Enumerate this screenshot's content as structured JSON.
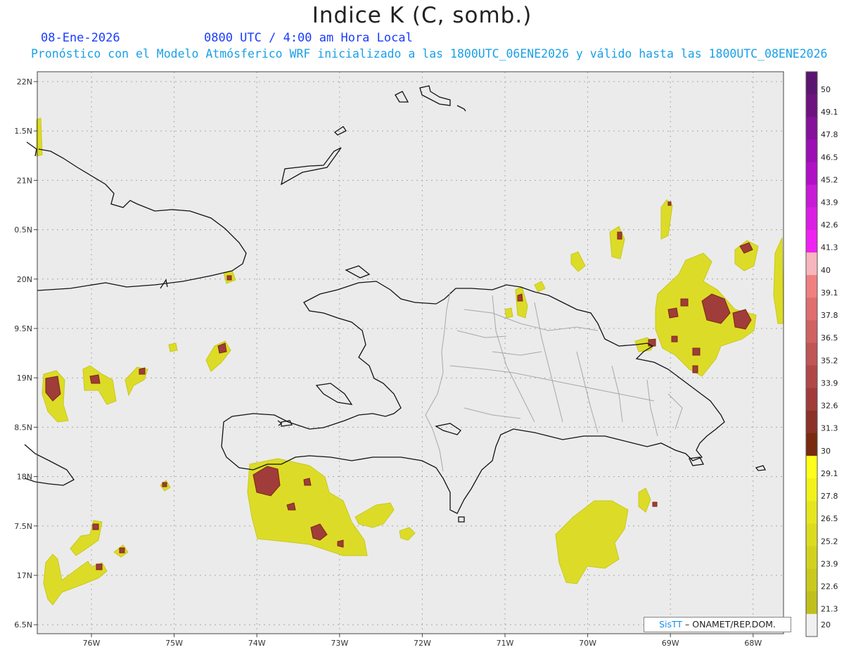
{
  "header": {
    "title": "Indice K (C, somb.)",
    "date": "08-Ene-2026",
    "time": "0800 UTC / 4:00 am Hora Local",
    "subtitle": "Pronóstico con el Modelo Atmósferico WRF inicializado a las 1800UTC_06ENE2026 y válido hasta las  1800UTC_08ENE2026"
  },
  "map": {
    "lat_ticks": [
      "22N",
      "1.5N",
      "21N",
      "0.5N",
      "20N",
      "9.5N",
      "19N",
      "8.5N",
      "18N",
      "7.5N",
      "17N",
      "6.5N"
    ],
    "lon_ticks": [
      "76W",
      "75W",
      "74W",
      "73W",
      "72W",
      "71W",
      "70W",
      "69W",
      "68W"
    ],
    "background_color": "#ebebeb"
  },
  "colorbar": {
    "labels": [
      "50",
      "49.1",
      "47.8",
      "46.5",
      "45.2",
      "43.9",
      "42.6",
      "41.3",
      "40",
      "39.1",
      "37.8",
      "36.5",
      "35.2",
      "33.9",
      "32.6",
      "31.3",
      "30",
      "29.1",
      "27.8",
      "26.5",
      "25.2",
      "23.9",
      "22.6",
      "21.3",
      "20"
    ],
    "colors": [
      "#5a1570",
      "#6e1280",
      "#86119a",
      "#9b0fb4",
      "#b10fc6",
      "#c81bd6",
      "#db1ee4",
      "#ef22f2",
      "#f7b5bd",
      "#f08080",
      "#e06e6e",
      "#d06262",
      "#c05555",
      "#b04848",
      "#a03c3a",
      "#8c3128",
      "#7a2a10",
      "#ffff1a",
      "#f2f21a",
      "#e6e61e",
      "#dcdc1e",
      "#d2d21e",
      "#c9c91e",
      "#c0c01c",
      "#f0f0f0"
    ]
  },
  "credit": {
    "brand": "SisTT",
    "text": "– ONAMET/REP.DOM."
  }
}
